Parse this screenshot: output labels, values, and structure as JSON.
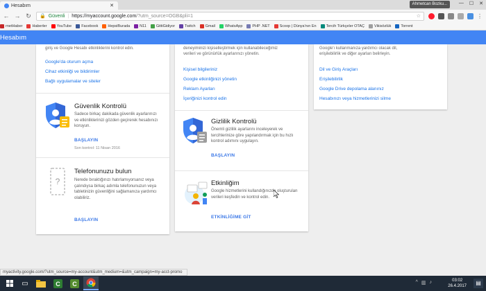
{
  "browser": {
    "tab_title": "Hesabım",
    "user_chip": "Ahmetcan Bozku...",
    "secure_label": "Güvenli",
    "url_host": "https://myaccount.google.com",
    "url_rest": "/?utm_source=OGB&pli=1",
    "bookmarks": [
      {
        "label": "rnetHaber",
        "color": "#c62828"
      },
      {
        "label": "Haberler",
        "color": "#e53935"
      },
      {
        "label": "YouTube",
        "color": "#ff0000"
      },
      {
        "label": "Facebook",
        "color": "#3b5998"
      },
      {
        "label": "HepsiBurada",
        "color": "#ff6000"
      },
      {
        "label": "N11",
        "color": "#7b1fa2"
      },
      {
        "label": "GittiGidiyor",
        "color": "#43a047"
      },
      {
        "label": "Twitch",
        "color": "#6441a5"
      },
      {
        "label": "Gmail",
        "color": "#d93025"
      },
      {
        "label": "WhatsApp",
        "color": "#25d366"
      },
      {
        "label": "PHP .NET",
        "color": "#777bb3"
      },
      {
        "label": "Scoop | Dünya'nın En",
        "color": "#e53935"
      },
      {
        "label": "Tercih Türkçeler OTAÇ",
        "color": "#00897b"
      },
      {
        "label": "Vikisözlük",
        "color": "#9e9e9e"
      },
      {
        "label": "Torrent",
        "color": "#1565c0"
      }
    ]
  },
  "header": {
    "title": "Hesabım"
  },
  "col1": {
    "top_text": "giriş ve Google Hesabı etkinliklerini kontrol edin.",
    "links": [
      "Google'da oturum açma",
      "Cihaz etkinliği ve bildirimler",
      "Bağlı uygulamalar ve siteler"
    ],
    "security": {
      "title": "Güvenlik Kontrolü",
      "desc": "Sadece birkaç dakikada güvenlik ayarlarınızı ve etkinliklerinizi gözden geçirerek hesabınızı koruyun.",
      "action": "BAŞLAYIN",
      "meta": "Son kontrol: 11 Nisan 2016"
    },
    "phone": {
      "title": "Telefonunuzu bulun",
      "desc": "Nerede bıraktığınızı hatırlamıyorsanız veya çalındıysa birkaç adımla telefonunuzun veya tabletinizin güvenliğini sağlamanıza yardımcı olabiliriz.",
      "action": "BAŞLAYIN"
    }
  },
  "col2": {
    "top_text_1": "deneyiminizi kişiselleştirmek için kullanabileceğimiz",
    "top_text_2": "verileri ve görünürlük ayarlarınızı yönetin.",
    "links": [
      "Kişisel bilgileriniz",
      "Google etkinliğinizi yönetin",
      "Reklam Ayarları",
      "İçeriğinizi kontrol edin"
    ],
    "privacy": {
      "title": "Gizlilik Kontrolü",
      "desc": "Önemli gizlilik ayarlarını inceleyerek ve tercihlerinize göre yapılandırmak için bu hızlı kontrol adımını uygulayın.",
      "action": "BAŞLAYIN"
    },
    "activity": {
      "title": "Etkinliğim",
      "desc": "Google hizmetlerini kullandığınızda oluşturulan verileri keşfedin ve kontrol edin.",
      "action": "ETKİNLİĞİME GİT"
    }
  },
  "col3": {
    "top_text_1": "Google'ı kullanmanıza yardımcı olacak dil,",
    "top_text_2": "erişilebilirlik ve diğer ayarları belirleyin.",
    "links": [
      "Dil ve Giriş Araçları",
      "Erişilebilirlik",
      "Google Drive depolama alanınız",
      "Hesabınızı veya hizmetlerinizi silme"
    ]
  },
  "status_url": "myactivity.google.com/?utm_source=my-account&utm_medium=&utm_campaign=my-acct-promo",
  "taskbar": {
    "time": "03:02",
    "date": "26.4.2017"
  }
}
